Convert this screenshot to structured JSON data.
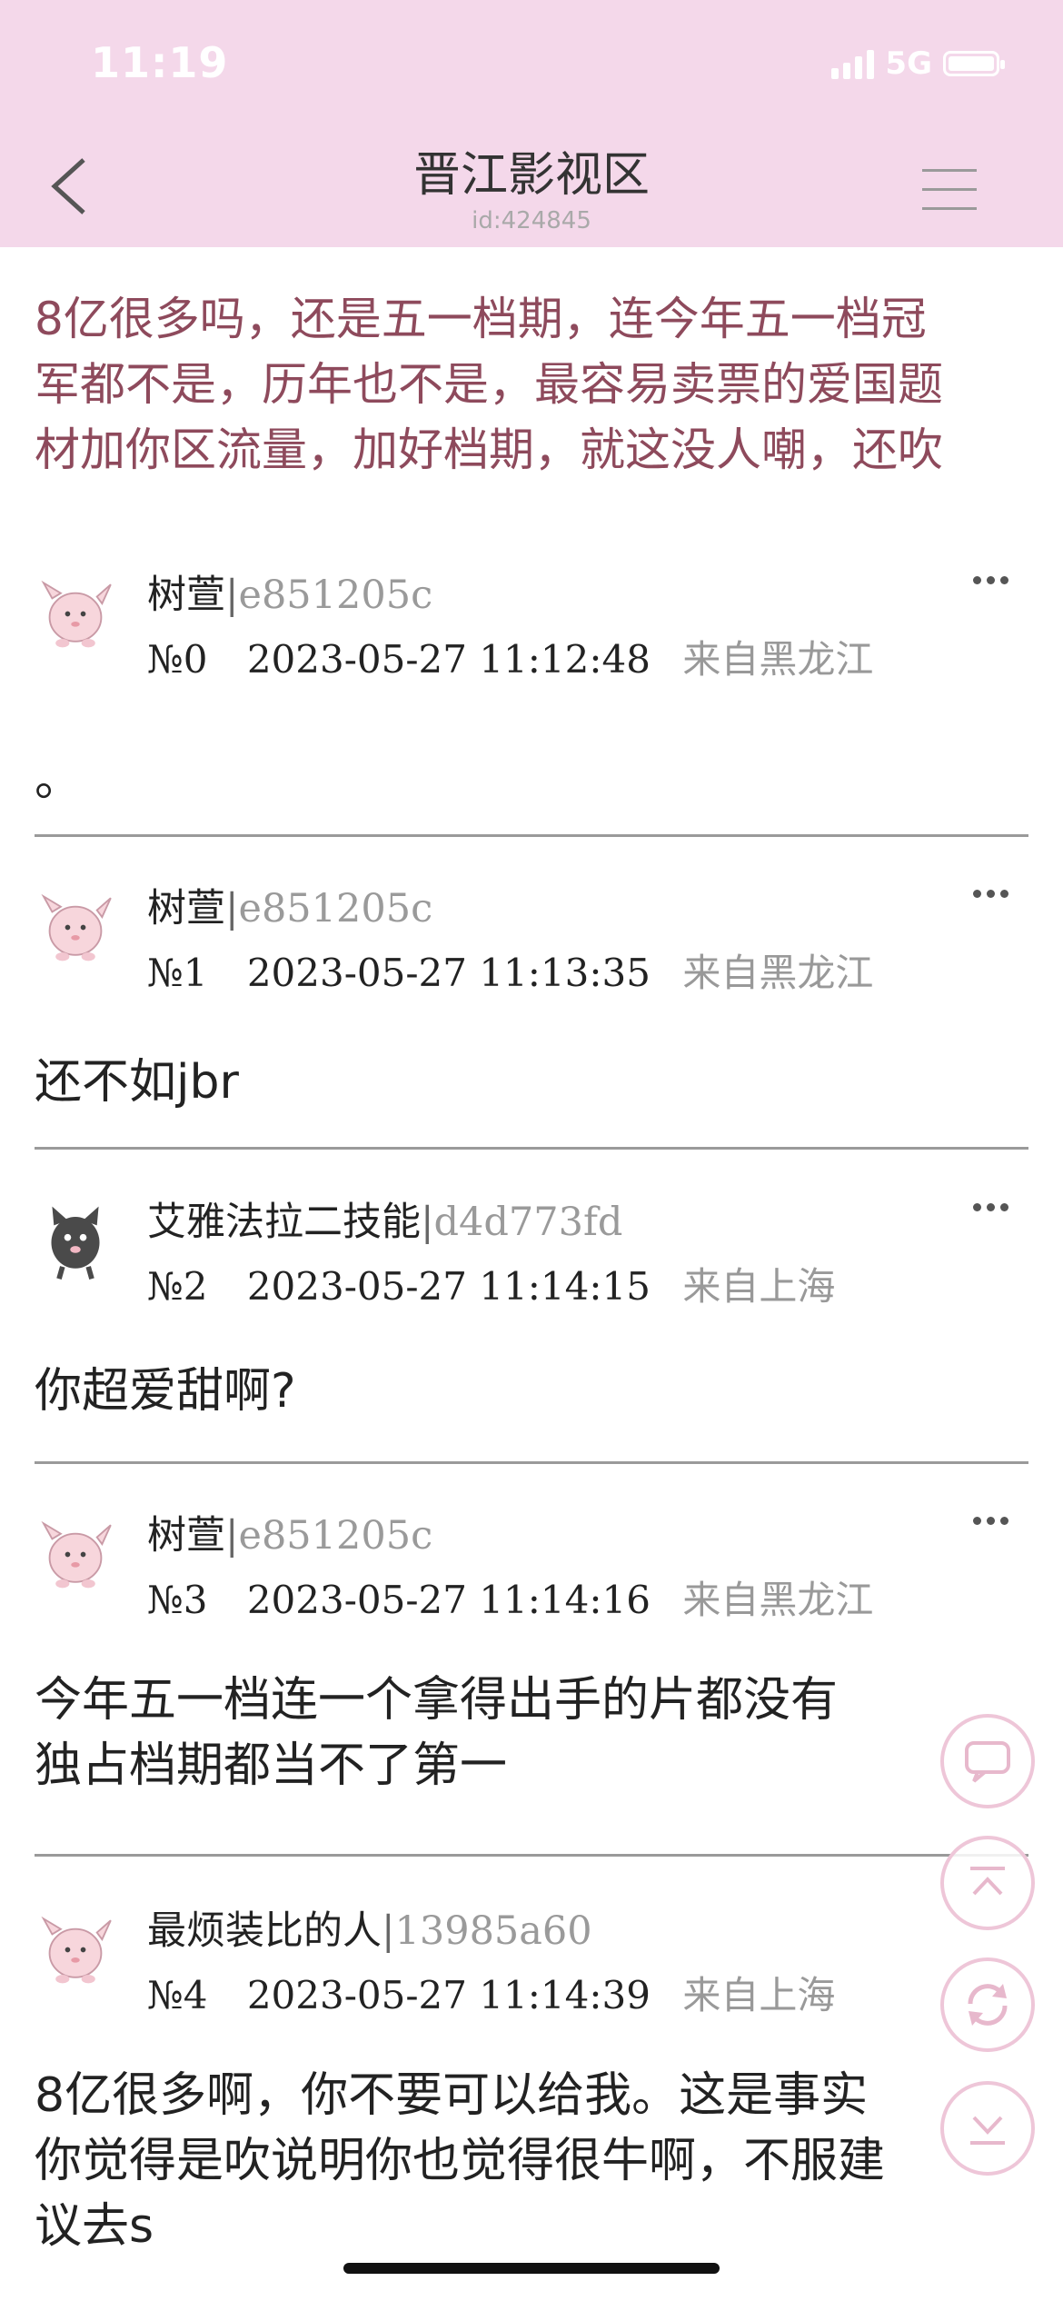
{
  "status_bar": {
    "time": "11:19",
    "network": "5G"
  },
  "header": {
    "title": "晋江影视区",
    "subtitle": "id:424845"
  },
  "intro": {
    "lines": [
      "8亿很多吗，还是五一档期，连今年五一档冠",
      "军都不是，历年也不是，最容易卖票的爱国题",
      "材加你区流量，加好档期，就这没人嘲，还吹"
    ]
  },
  "posts": [
    {
      "name": "树萱",
      "sep": "|",
      "uid": "e851205c",
      "num": "№0",
      "time": "2023-05-27 11:12:48",
      "loc": "来自黑龙江",
      "content": [
        "。"
      ],
      "avatar": "pink-creature-avatar"
    },
    {
      "name": "树萱",
      "sep": "|",
      "uid": "e851205c",
      "num": "№1",
      "time": "2023-05-27 11:13:35",
      "loc": "来自黑龙江",
      "content": [
        "还不如jbr"
      ],
      "avatar": "pink-creature-avatar"
    },
    {
      "name": "艾雅法拉二技能",
      "sep": "|",
      "uid": "d4d773fd",
      "num": "№2",
      "time": "2023-05-27 11:14:15",
      "loc": "来自上海",
      "content": [
        "你超爱甜啊?"
      ],
      "avatar": "gray-cat-avatar"
    },
    {
      "name": "树萱",
      "sep": "|",
      "uid": "e851205c",
      "num": "№3",
      "time": "2023-05-27 11:14:16",
      "loc": "来自黑龙江",
      "content": [
        "今年五一档连一个拿得出手的片都没有",
        "独占档期都当不了第一"
      ],
      "avatar": "pink-creature-avatar"
    },
    {
      "name": "最烦装比的人",
      "sep": "|",
      "uid": "13985a60",
      "num": "№4",
      "time": "2023-05-27 11:14:39",
      "loc": "来自上海",
      "content": [
        "8亿很多啊，你不要可以给我。这是事实",
        "你觉得是吹说明你也觉得很牛啊，不服建",
        "议去s"
      ],
      "avatar": "pink-creature-avatar"
    }
  ],
  "floating_buttons": [
    "comment-icon",
    "scroll-top-icon",
    "refresh-icon",
    "scroll-bottom-icon"
  ]
}
